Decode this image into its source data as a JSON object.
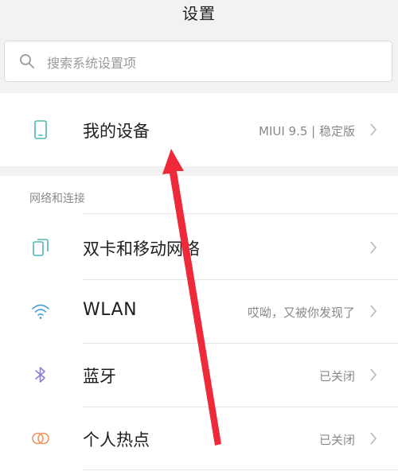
{
  "header": {
    "title": "设置"
  },
  "search": {
    "placeholder": "搜索系统设置项",
    "icon": "search-icon"
  },
  "device": {
    "label": "我的设备",
    "value": "MIUI 9.5 | 稳定版",
    "icon": "phone-icon"
  },
  "network": {
    "section_title": "网络和连接",
    "items": [
      {
        "label": "双卡和移动网络",
        "value": "",
        "icon": "dual-sim-icon"
      },
      {
        "label": "WLAN",
        "value": "哎呦，又被你发现了",
        "icon": "wifi-icon"
      },
      {
        "label": "蓝牙",
        "value": "已关闭",
        "icon": "bluetooth-icon"
      },
      {
        "label": "个人热点",
        "value": "已关闭",
        "icon": "hotspot-icon"
      }
    ]
  },
  "colors": {
    "background": "#f2f2f2",
    "card": "#ffffff",
    "icon_teal": "#4fb7b2",
    "icon_blue": "#49a4d6",
    "icon_purple": "#8a7fd4",
    "icon_orange": "#f0935b",
    "annotation_arrow": "#ee2a3a"
  }
}
